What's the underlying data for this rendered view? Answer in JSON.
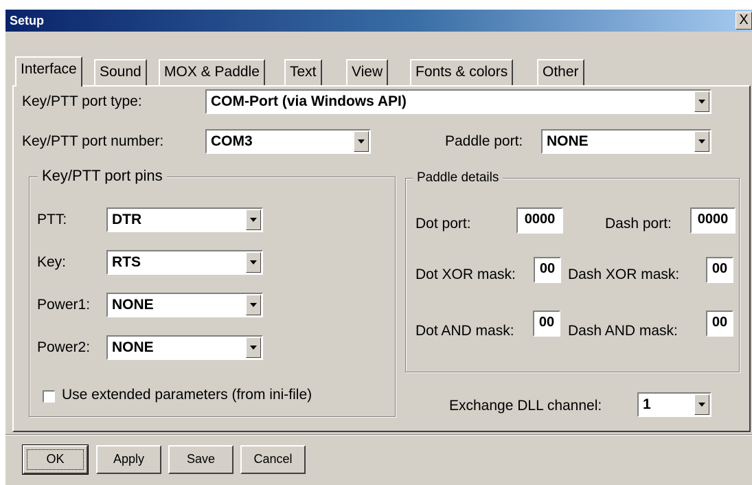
{
  "window": {
    "title": "Setup",
    "close_glyph": "X"
  },
  "tabs": [
    {
      "label": "Interface",
      "active": true
    },
    {
      "label": "Sound"
    },
    {
      "label": "MOX & Paddle"
    },
    {
      "label": "Text"
    },
    {
      "label": "View"
    },
    {
      "label": "Fonts & colors"
    },
    {
      "label": "Other"
    }
  ],
  "interface": {
    "port_type": {
      "label": "Key/PTT port type:",
      "value": "COM-Port (via Windows API)"
    },
    "port_number": {
      "label": "Key/PTT port number:",
      "value": "COM3"
    },
    "paddle_port": {
      "label": "Paddle port:",
      "value": "NONE"
    },
    "pins_group": {
      "title": "Key/PTT port pins",
      "ptt": {
        "label": "PTT:",
        "value": "DTR"
      },
      "key": {
        "label": "Key:",
        "value": "RTS"
      },
      "power1": {
        "label": "Power1:",
        "value": "NONE"
      },
      "power2": {
        "label": "Power2:",
        "value": "NONE"
      },
      "extended": {
        "label": "Use extended parameters (from ini-file)",
        "checked": false
      }
    },
    "paddle_group": {
      "title": "Paddle details",
      "dot_port": {
        "label": "Dot port:",
        "value": "0000"
      },
      "dash_port": {
        "label": "Dash port:",
        "value": "0000"
      },
      "dot_xor": {
        "label": "Dot XOR mask:",
        "value": "00"
      },
      "dash_xor": {
        "label": "Dash XOR mask:",
        "value": "00"
      },
      "dot_and": {
        "label": "Dot AND mask:",
        "value": "00"
      },
      "dash_and": {
        "label": "Dash AND mask:",
        "value": "00"
      }
    },
    "exchange_dll": {
      "label": "Exchange DLL channel:",
      "value": "1"
    }
  },
  "buttons": {
    "ok": "OK",
    "apply": "Apply",
    "save": "Save",
    "cancel": "Cancel"
  },
  "colors": {
    "title_gradient_start": "#0a246a",
    "title_gradient_end": "#a6caf0",
    "face": "#d4d0c8"
  }
}
